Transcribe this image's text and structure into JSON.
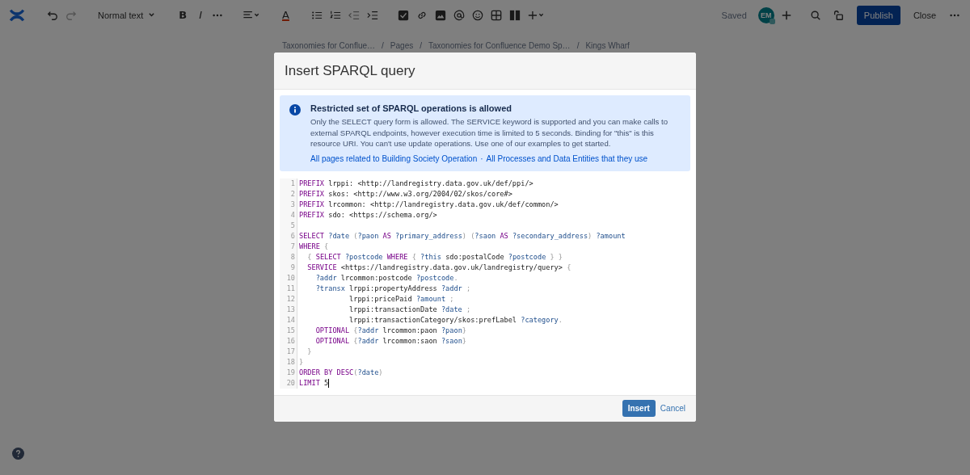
{
  "toolbar": {
    "format_menu": "Normal text",
    "text_style_buttons": [
      {
        "kind": "bold",
        "glyph": "B"
      },
      {
        "kind": "italic",
        "glyph": "I"
      }
    ],
    "text_color_glyph": "A",
    "saved": "Saved",
    "avatar": "EM",
    "publish": "Publish",
    "close": "Close"
  },
  "breadcrumb": [
    {
      "label": "Taxonomies for Conflue…"
    },
    {
      "sep": "/",
      "label": "Pages"
    },
    {
      "sep": "/",
      "label": "Taxonomies for Confluence Demo Sp…"
    },
    {
      "sep": "/",
      "label": "Kings Wharf"
    }
  ],
  "dialog": {
    "title": "Insert SPARQL query",
    "notice": {
      "title": "Restricted set of SPARQL operations is allowed",
      "body": "Only the SELECT query form is allowed. The SERVICE keyword is supported and you can make calls to external SPARQL endpoints, however execution time is limited to 5 seconds. Binding for \"this\" is this resource URI. You can't use update operations. Use one of our examples to get started.",
      "links": [
        {
          "label": "All pages related to Building Society Operation"
        },
        {
          "sep": "·",
          "label": "All Processes and Data Entities that they use"
        }
      ]
    },
    "editor": {
      "lines": [
        {
          "number": "1",
          "cursor": false,
          "tokens": [
            {
              "t": "PREFIX",
              "kind": "keyword"
            },
            {
              "t": " lrppi: <http://landregistry.data.gov.uk/def/ppi/>",
              "kind": "plain"
            }
          ]
        },
        {
          "number": "2",
          "cursor": false,
          "tokens": [
            {
              "t": "PREFIX",
              "kind": "keyword"
            },
            {
              "t": " skos: <http://www.w3.org/2004/02/skos/core#>",
              "kind": "plain"
            }
          ]
        },
        {
          "number": "3",
          "cursor": false,
          "tokens": [
            {
              "t": "PREFIX",
              "kind": "keyword"
            },
            {
              "t": " lrcommon: <http://landregistry.data.gov.uk/def/common/>",
              "kind": "plain"
            }
          ]
        },
        {
          "number": "4",
          "cursor": false,
          "tokens": [
            {
              "t": "PREFIX",
              "kind": "keyword"
            },
            {
              "t": " sdo: <https://schema.org/>",
              "kind": "plain"
            }
          ]
        },
        {
          "number": "5",
          "cursor": false
        },
        {
          "number": "6",
          "cursor": false,
          "tokens": [
            {
              "t": "SELECT",
              "kind": "keyword"
            },
            {
              "t": " ?date",
              "kind": "variable"
            },
            {
              "t": " (",
              "kind": "punct"
            },
            {
              "t": "?paon",
              "kind": "variable"
            },
            {
              "t": " AS",
              "kind": "keyword"
            },
            {
              "t": " ?primary_address",
              "kind": "variable"
            },
            {
              "t": ") (",
              "kind": "punct"
            },
            {
              "t": "?saon",
              "kind": "variable"
            },
            {
              "t": " AS",
              "kind": "keyword"
            },
            {
              "t": " ?secondary_address",
              "kind": "variable"
            },
            {
              "t": ") ",
              "kind": "punct"
            },
            {
              "t": "?amount",
              "kind": "variable"
            }
          ]
        },
        {
          "number": "7",
          "cursor": false,
          "tokens": [
            {
              "t": "WHERE",
              "kind": "keyword"
            },
            {
              "t": " {",
              "kind": "punct"
            }
          ]
        },
        {
          "number": "8",
          "cursor": false,
          "tokens": [
            {
              "t": "  { ",
              "kind": "punct"
            },
            {
              "t": "SELECT",
              "kind": "keyword"
            },
            {
              "t": " ?postcode",
              "kind": "variable"
            },
            {
              "t": " WHERE",
              "kind": "keyword"
            },
            {
              "t": " { ",
              "kind": "punct"
            },
            {
              "t": "?this",
              "kind": "variable"
            },
            {
              "t": " sdo:postalCode ",
              "kind": "plain"
            },
            {
              "t": "?postcode",
              "kind": "variable"
            },
            {
              "t": " } }",
              "kind": "punct"
            }
          ]
        },
        {
          "number": "9",
          "cursor": false,
          "tokens": [
            {
              "t": "  SERVICE",
              "kind": "keyword"
            },
            {
              "t": " <https://landregistry.data.gov.uk/landregistry/query>",
              "kind": "plain"
            },
            {
              "t": " {",
              "kind": "punct"
            }
          ]
        },
        {
          "number": "10",
          "cursor": false,
          "tokens": [
            {
              "t": "    ?addr",
              "kind": "variable"
            },
            {
              "t": " lrcommon:postcode ",
              "kind": "plain"
            },
            {
              "t": "?postcode",
              "kind": "variable"
            },
            {
              "t": ".",
              "kind": "punct"
            }
          ]
        },
        {
          "number": "11",
          "cursor": false,
          "tokens": [
            {
              "t": "    ?transx",
              "kind": "variable"
            },
            {
              "t": " lrppi:propertyAddress ",
              "kind": "plain"
            },
            {
              "t": "?addr",
              "kind": "variable"
            },
            {
              "t": " ;",
              "kind": "punct"
            }
          ]
        },
        {
          "number": "12",
          "cursor": false,
          "tokens": [
            {
              "t": "            lrppi:pricePaid ",
              "kind": "plain"
            },
            {
              "t": "?amount",
              "kind": "variable"
            },
            {
              "t": " ;",
              "kind": "punct"
            }
          ]
        },
        {
          "number": "13",
          "cursor": false,
          "tokens": [
            {
              "t": "            lrppi:transactionDate ",
              "kind": "plain"
            },
            {
              "t": "?date",
              "kind": "variable"
            },
            {
              "t": " ;",
              "kind": "punct"
            }
          ]
        },
        {
          "number": "14",
          "cursor": false,
          "tokens": [
            {
              "t": "            lrppi:transactionCategory/skos:prefLabel ",
              "kind": "plain"
            },
            {
              "t": "?category",
              "kind": "variable"
            },
            {
              "t": ".",
              "kind": "punct"
            }
          ]
        },
        {
          "number": "15",
          "cursor": false,
          "tokens": [
            {
              "t": "    OPTIONAL",
              "kind": "keyword"
            },
            {
              "t": " {",
              "kind": "punct"
            },
            {
              "t": "?addr",
              "kind": "variable"
            },
            {
              "t": " lrcommon:paon ",
              "kind": "plain"
            },
            {
              "t": "?paon",
              "kind": "variable"
            },
            {
              "t": "}",
              "kind": "punct"
            }
          ]
        },
        {
          "number": "16",
          "cursor": false,
          "tokens": [
            {
              "t": "    OPTIONAL",
              "kind": "keyword"
            },
            {
              "t": " {",
              "kind": "punct"
            },
            {
              "t": "?addr",
              "kind": "variable"
            },
            {
              "t": " lrcommon:saon ",
              "kind": "plain"
            },
            {
              "t": "?saon",
              "kind": "variable"
            },
            {
              "t": "}",
              "kind": "punct"
            }
          ]
        },
        {
          "number": "17",
          "cursor": false,
          "tokens": [
            {
              "t": "  }",
              "kind": "punct"
            }
          ]
        },
        {
          "number": "18",
          "cursor": false,
          "tokens": [
            {
              "t": "}",
              "kind": "punct"
            }
          ]
        },
        {
          "number": "19",
          "cursor": false,
          "tokens": [
            {
              "t": "ORDER BY DESC",
              "kind": "keyword"
            },
            {
              "t": "(",
              "kind": "punct"
            },
            {
              "t": "?date",
              "kind": "variable"
            },
            {
              "t": ")",
              "kind": "punct"
            }
          ]
        },
        {
          "number": "20",
          "cursor": true,
          "tokens": [
            {
              "t": "LIMIT",
              "kind": "keyword"
            },
            {
              "t": " 5",
              "kind": "plain"
            }
          ]
        }
      ]
    },
    "buttons": {
      "insert": "Insert",
      "cancel": "Cancel"
    }
  }
}
